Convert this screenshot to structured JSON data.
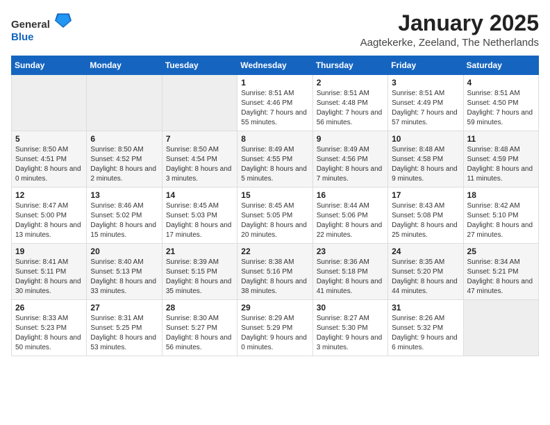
{
  "header": {
    "logo_general": "General",
    "logo_blue": "Blue",
    "title": "January 2025",
    "subtitle": "Aagtekerke, Zeeland, The Netherlands"
  },
  "days_of_week": [
    "Sunday",
    "Monday",
    "Tuesday",
    "Wednesday",
    "Thursday",
    "Friday",
    "Saturday"
  ],
  "weeks": [
    [
      {
        "day": "",
        "sunrise": "",
        "sunset": "",
        "daylight": "",
        "empty": true
      },
      {
        "day": "",
        "sunrise": "",
        "sunset": "",
        "daylight": "",
        "empty": true
      },
      {
        "day": "",
        "sunrise": "",
        "sunset": "",
        "daylight": "",
        "empty": true
      },
      {
        "day": "1",
        "sunrise": "Sunrise: 8:51 AM",
        "sunset": "Sunset: 4:46 PM",
        "daylight": "Daylight: 7 hours and 55 minutes."
      },
      {
        "day": "2",
        "sunrise": "Sunrise: 8:51 AM",
        "sunset": "Sunset: 4:48 PM",
        "daylight": "Daylight: 7 hours and 56 minutes."
      },
      {
        "day": "3",
        "sunrise": "Sunrise: 8:51 AM",
        "sunset": "Sunset: 4:49 PM",
        "daylight": "Daylight: 7 hours and 57 minutes."
      },
      {
        "day": "4",
        "sunrise": "Sunrise: 8:51 AM",
        "sunset": "Sunset: 4:50 PM",
        "daylight": "Daylight: 7 hours and 59 minutes."
      }
    ],
    [
      {
        "day": "5",
        "sunrise": "Sunrise: 8:50 AM",
        "sunset": "Sunset: 4:51 PM",
        "daylight": "Daylight: 8 hours and 0 minutes."
      },
      {
        "day": "6",
        "sunrise": "Sunrise: 8:50 AM",
        "sunset": "Sunset: 4:52 PM",
        "daylight": "Daylight: 8 hours and 2 minutes."
      },
      {
        "day": "7",
        "sunrise": "Sunrise: 8:50 AM",
        "sunset": "Sunset: 4:54 PM",
        "daylight": "Daylight: 8 hours and 3 minutes."
      },
      {
        "day": "8",
        "sunrise": "Sunrise: 8:49 AM",
        "sunset": "Sunset: 4:55 PM",
        "daylight": "Daylight: 8 hours and 5 minutes."
      },
      {
        "day": "9",
        "sunrise": "Sunrise: 8:49 AM",
        "sunset": "Sunset: 4:56 PM",
        "daylight": "Daylight: 8 hours and 7 minutes."
      },
      {
        "day": "10",
        "sunrise": "Sunrise: 8:48 AM",
        "sunset": "Sunset: 4:58 PM",
        "daylight": "Daylight: 8 hours and 9 minutes."
      },
      {
        "day": "11",
        "sunrise": "Sunrise: 8:48 AM",
        "sunset": "Sunset: 4:59 PM",
        "daylight": "Daylight: 8 hours and 11 minutes."
      }
    ],
    [
      {
        "day": "12",
        "sunrise": "Sunrise: 8:47 AM",
        "sunset": "Sunset: 5:00 PM",
        "daylight": "Daylight: 8 hours and 13 minutes."
      },
      {
        "day": "13",
        "sunrise": "Sunrise: 8:46 AM",
        "sunset": "Sunset: 5:02 PM",
        "daylight": "Daylight: 8 hours and 15 minutes."
      },
      {
        "day": "14",
        "sunrise": "Sunrise: 8:45 AM",
        "sunset": "Sunset: 5:03 PM",
        "daylight": "Daylight: 8 hours and 17 minutes."
      },
      {
        "day": "15",
        "sunrise": "Sunrise: 8:45 AM",
        "sunset": "Sunset: 5:05 PM",
        "daylight": "Daylight: 8 hours and 20 minutes."
      },
      {
        "day": "16",
        "sunrise": "Sunrise: 8:44 AM",
        "sunset": "Sunset: 5:06 PM",
        "daylight": "Daylight: 8 hours and 22 minutes."
      },
      {
        "day": "17",
        "sunrise": "Sunrise: 8:43 AM",
        "sunset": "Sunset: 5:08 PM",
        "daylight": "Daylight: 8 hours and 25 minutes."
      },
      {
        "day": "18",
        "sunrise": "Sunrise: 8:42 AM",
        "sunset": "Sunset: 5:10 PM",
        "daylight": "Daylight: 8 hours and 27 minutes."
      }
    ],
    [
      {
        "day": "19",
        "sunrise": "Sunrise: 8:41 AM",
        "sunset": "Sunset: 5:11 PM",
        "daylight": "Daylight: 8 hours and 30 minutes."
      },
      {
        "day": "20",
        "sunrise": "Sunrise: 8:40 AM",
        "sunset": "Sunset: 5:13 PM",
        "daylight": "Daylight: 8 hours and 33 minutes."
      },
      {
        "day": "21",
        "sunrise": "Sunrise: 8:39 AM",
        "sunset": "Sunset: 5:15 PM",
        "daylight": "Daylight: 8 hours and 35 minutes."
      },
      {
        "day": "22",
        "sunrise": "Sunrise: 8:38 AM",
        "sunset": "Sunset: 5:16 PM",
        "daylight": "Daylight: 8 hours and 38 minutes."
      },
      {
        "day": "23",
        "sunrise": "Sunrise: 8:36 AM",
        "sunset": "Sunset: 5:18 PM",
        "daylight": "Daylight: 8 hours and 41 minutes."
      },
      {
        "day": "24",
        "sunrise": "Sunrise: 8:35 AM",
        "sunset": "Sunset: 5:20 PM",
        "daylight": "Daylight: 8 hours and 44 minutes."
      },
      {
        "day": "25",
        "sunrise": "Sunrise: 8:34 AM",
        "sunset": "Sunset: 5:21 PM",
        "daylight": "Daylight: 8 hours and 47 minutes."
      }
    ],
    [
      {
        "day": "26",
        "sunrise": "Sunrise: 8:33 AM",
        "sunset": "Sunset: 5:23 PM",
        "daylight": "Daylight: 8 hours and 50 minutes."
      },
      {
        "day": "27",
        "sunrise": "Sunrise: 8:31 AM",
        "sunset": "Sunset: 5:25 PM",
        "daylight": "Daylight: 8 hours and 53 minutes."
      },
      {
        "day": "28",
        "sunrise": "Sunrise: 8:30 AM",
        "sunset": "Sunset: 5:27 PM",
        "daylight": "Daylight: 8 hours and 56 minutes."
      },
      {
        "day": "29",
        "sunrise": "Sunrise: 8:29 AM",
        "sunset": "Sunset: 5:29 PM",
        "daylight": "Daylight: 9 hours and 0 minutes."
      },
      {
        "day": "30",
        "sunrise": "Sunrise: 8:27 AM",
        "sunset": "Sunset: 5:30 PM",
        "daylight": "Daylight: 9 hours and 3 minutes."
      },
      {
        "day": "31",
        "sunrise": "Sunrise: 8:26 AM",
        "sunset": "Sunset: 5:32 PM",
        "daylight": "Daylight: 9 hours and 6 minutes."
      },
      {
        "day": "",
        "sunrise": "",
        "sunset": "",
        "daylight": "",
        "empty": true
      }
    ]
  ]
}
